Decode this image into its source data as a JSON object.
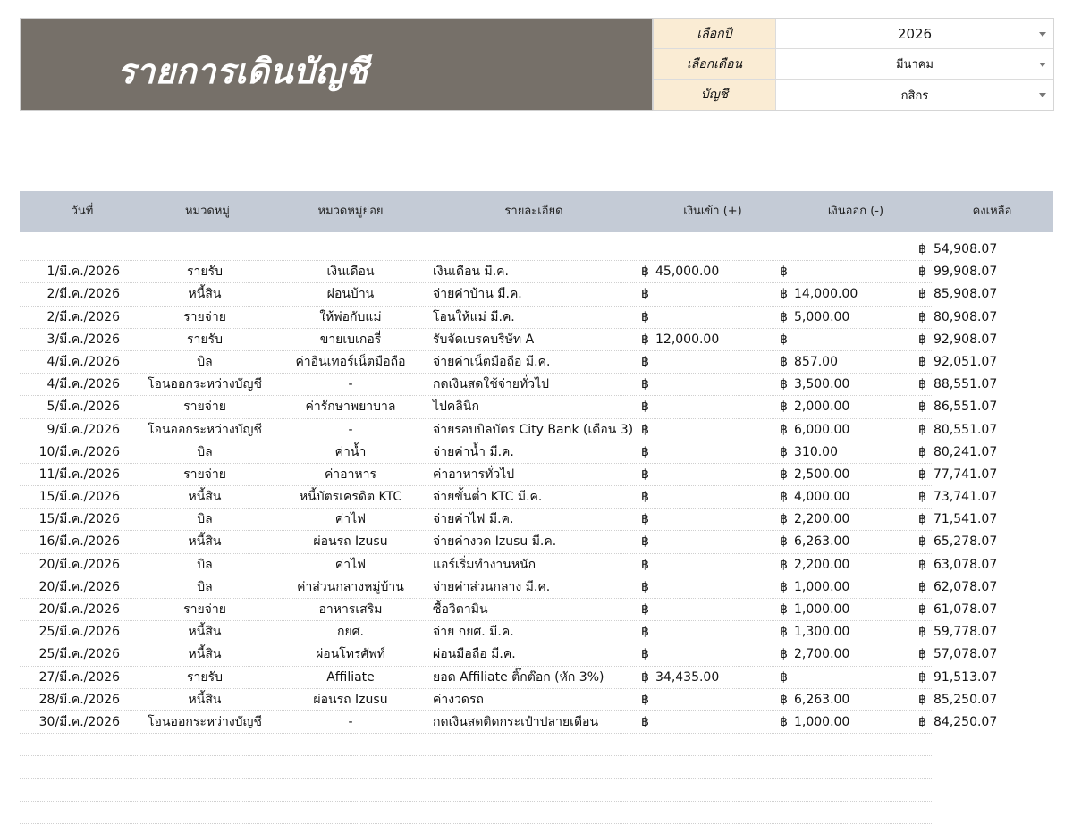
{
  "header": {
    "title": "รายการเดินบัญชี",
    "filters": [
      {
        "label": "เลือกปี",
        "value": "2026"
      },
      {
        "label": "เลือกเดือน",
        "value": "มีนาคม"
      },
      {
        "label": "บัญชี",
        "value": "กสิกร"
      }
    ]
  },
  "currency_symbol": "฿",
  "table": {
    "columns": [
      "วันที่",
      "หมวดหมู่",
      "หมวดหมู่ย่อย",
      "รายละเอียด",
      "เงินเข้า (+)",
      "เงินออก (-)",
      "คงเหลือ"
    ],
    "opening_balance": "54,908.07",
    "rows": [
      {
        "date": "1/มี.ค./2026",
        "cat": "รายรับ",
        "sub": "เงินเดือน",
        "detail": "เงินเดือน มี.ค.",
        "in": "45,000.00",
        "out": "",
        "bal": "99,908.07"
      },
      {
        "date": "2/มี.ค./2026",
        "cat": "หนี้สิน",
        "sub": "ผ่อนบ้าน",
        "detail": "จ่ายค่าบ้าน มี.ค.",
        "in": "",
        "out": "14,000.00",
        "bal": "85,908.07"
      },
      {
        "date": "2/มี.ค./2026",
        "cat": "รายจ่าย",
        "sub": "ให้พ่อกับแม่",
        "detail": "โอนให้แม่ มี.ค.",
        "in": "",
        "out": "5,000.00",
        "bal": "80,908.07"
      },
      {
        "date": "3/มี.ค./2026",
        "cat": "รายรับ",
        "sub": "ขายเบเกอรี่",
        "detail": "รับจัดเบรคบริษัท A",
        "in": "12,000.00",
        "out": "",
        "bal": "92,908.07"
      },
      {
        "date": "4/มี.ค./2026",
        "cat": "บิล",
        "sub": "ค่าอินเทอร์เน็ตมือถือ",
        "detail": "จ่ายค่าเน็ตมือถือ มี.ค.",
        "in": "",
        "out": "857.00",
        "bal": "92,051.07"
      },
      {
        "date": "4/มี.ค./2026",
        "cat": "โอนออกระหว่างบัญชี",
        "sub": "-",
        "detail": "กดเงินสดใช้จ่ายทั่วไป",
        "in": "",
        "out": "3,500.00",
        "bal": "88,551.07"
      },
      {
        "date": "5/มี.ค./2026",
        "cat": "รายจ่าย",
        "sub": "ค่ารักษาพยาบาล",
        "detail": "ไปคลินิก",
        "in": "",
        "out": "2,000.00",
        "bal": "86,551.07"
      },
      {
        "date": "9/มี.ค./2026",
        "cat": "โอนออกระหว่างบัญชี",
        "sub": "-",
        "detail": "จ่ายรอบบิลบัตร City Bank (เดือน 3)",
        "in": "",
        "out": "6,000.00",
        "bal": "80,551.07"
      },
      {
        "date": "10/มี.ค./2026",
        "cat": "บิล",
        "sub": "ค่าน้ำ",
        "detail": "จ่ายค่าน้ำ มี.ค.",
        "in": "",
        "out": "310.00",
        "bal": "80,241.07"
      },
      {
        "date": "11/มี.ค./2026",
        "cat": "รายจ่าย",
        "sub": "ค่าอาหาร",
        "detail": "ค่าอาหารทั่วไป",
        "in": "",
        "out": "2,500.00",
        "bal": "77,741.07"
      },
      {
        "date": "15/มี.ค./2026",
        "cat": "หนี้สิน",
        "sub": "หนี้บัตรเครดิต KTC",
        "detail": "จ่ายขั้นต่ำ KTC มี.ค.",
        "in": "",
        "out": "4,000.00",
        "bal": "73,741.07"
      },
      {
        "date": "15/มี.ค./2026",
        "cat": "บิล",
        "sub": "ค่าไฟ",
        "detail": "จ่ายค่าไฟ มี.ค.",
        "in": "",
        "out": "2,200.00",
        "bal": "71,541.07"
      },
      {
        "date": "16/มี.ค./2026",
        "cat": "หนี้สิน",
        "sub": "ผ่อนรถ Izusu",
        "detail": "จ่ายค่างวด Izusu มี.ค.",
        "in": "",
        "out": "6,263.00",
        "bal": "65,278.07"
      },
      {
        "date": "20/มี.ค./2026",
        "cat": "บิล",
        "sub": "ค่าไฟ",
        "detail": "แอร์เริ่มทำงานหนัก",
        "in": "",
        "out": "2,200.00",
        "bal": "63,078.07"
      },
      {
        "date": "20/มี.ค./2026",
        "cat": "บิล",
        "sub": "ค่าส่วนกลางหมู่บ้าน",
        "detail": "จ่ายค่าส่วนกลาง มี.ค.",
        "in": "",
        "out": "1,000.00",
        "bal": "62,078.07"
      },
      {
        "date": "20/มี.ค./2026",
        "cat": "รายจ่าย",
        "sub": "อาหารเสริม",
        "detail": "ซื้อวิตามิน",
        "in": "",
        "out": "1,000.00",
        "bal": "61,078.07"
      },
      {
        "date": "25/มี.ค./2026",
        "cat": "หนี้สิน",
        "sub": "กยศ.",
        "detail": "จ่าย กยศ. มี.ค.",
        "in": "",
        "out": "1,300.00",
        "bal": "59,778.07"
      },
      {
        "date": "25/มี.ค./2026",
        "cat": "หนี้สิน",
        "sub": "ผ่อนโทรศัพท์",
        "detail": "ผ่อนมือถือ มี.ค.",
        "in": "",
        "out": "2,700.00",
        "bal": "57,078.07"
      },
      {
        "date": "27/มี.ค./2026",
        "cat": "รายรับ",
        "sub": "Affiliate",
        "detail": "ยอด Affiliate ติ๊กต๊อก (หัก 3%)",
        "in": "34,435.00",
        "out": "",
        "bal": "91,513.07"
      },
      {
        "date": "28/มี.ค./2026",
        "cat": "หนี้สิน",
        "sub": "ผ่อนรถ Izusu",
        "detail": "ค่างวดรถ",
        "in": "",
        "out": "6,263.00",
        "bal": "85,250.07"
      },
      {
        "date": "30/มี.ค./2026",
        "cat": "โอนออกระหว่างบัญชี",
        "sub": "-",
        "detail": "กดเงินสดติดกระเป๋าปลายเดือน",
        "in": "",
        "out": "1,000.00",
        "bal": "84,250.07"
      }
    ]
  }
}
